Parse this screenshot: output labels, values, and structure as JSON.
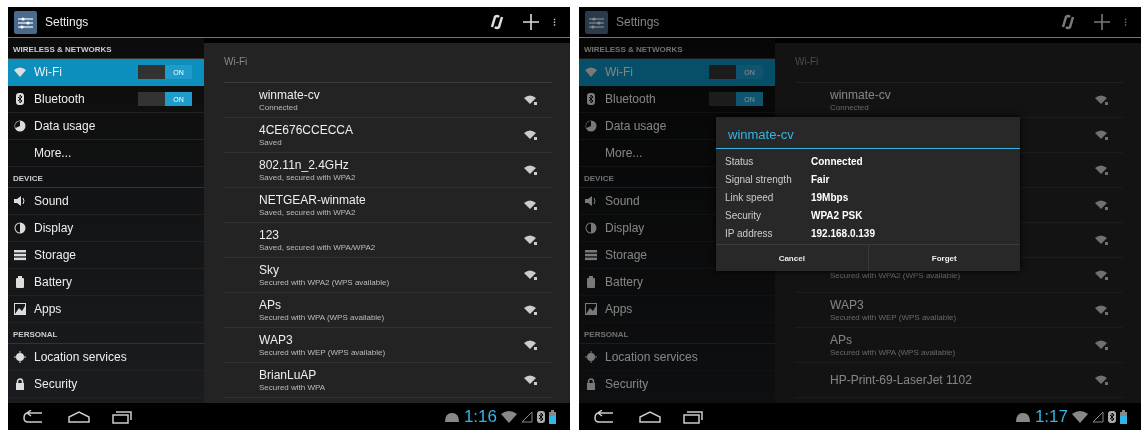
{
  "screens": [
    {
      "dimmed": false,
      "action_bar": {
        "title": "Settings"
      },
      "sidebar": [
        {
          "heading": "WIRELESS & NETWORKS",
          "items": [
            {
              "kind": "wifi",
              "label": "Wi-Fi",
              "selected": true,
              "switch": {
                "label": "ON",
                "on": true
              }
            },
            {
              "kind": "bluetooth",
              "label": "Bluetooth",
              "selected": false,
              "switch": {
                "label": "ON",
                "on": true
              }
            },
            {
              "kind": "data",
              "label": "Data usage",
              "selected": false
            },
            {
              "kind": "none",
              "label": "More...",
              "selected": false
            }
          ]
        },
        {
          "heading": "DEVICE",
          "items": [
            {
              "kind": "sound",
              "label": "Sound",
              "selected": false
            },
            {
              "kind": "display",
              "label": "Display",
              "selected": false
            },
            {
              "kind": "storage",
              "label": "Storage",
              "selected": false
            },
            {
              "kind": "battery",
              "label": "Battery",
              "selected": false
            },
            {
              "kind": "apps",
              "label": "Apps",
              "selected": false
            }
          ]
        },
        {
          "heading": "PERSONAL",
          "items": [
            {
              "kind": "location",
              "label": "Location services",
              "selected": false
            },
            {
              "kind": "lock",
              "label": "Security",
              "selected": false
            }
          ]
        }
      ],
      "panel": {
        "title": "Wi-Fi",
        "networks": [
          {
            "kind": "network",
            "ssid": "winmate-cv",
            "status": "Connected"
          },
          {
            "kind": "network",
            "ssid": "4CE676CCECCA",
            "status": "Saved"
          },
          {
            "kind": "network",
            "ssid": "802.11n_2.4GHz",
            "status": "Saved, secured with WPA2"
          },
          {
            "kind": "network",
            "ssid": "NETGEAR-winmate",
            "status": "Saved, secured with WPA2"
          },
          {
            "kind": "network",
            "ssid": "123",
            "status": "Saved, secured with WPA/WPA2"
          },
          {
            "kind": "network",
            "ssid": "Sky",
            "status": "Secured with WPA2 (WPS available)"
          },
          {
            "kind": "network",
            "ssid": "APs",
            "status": "Secured with WPA (WPS available)"
          },
          {
            "kind": "network",
            "ssid": "WAP3",
            "status": "Secured with WEP (WPS available)"
          },
          {
            "kind": "network",
            "ssid": "BrianLuAP",
            "status": "Secured with WPA"
          }
        ]
      },
      "status_bar": {
        "time": "1:16"
      }
    },
    {
      "dimmed": true,
      "action_bar": {
        "title": "Settings"
      },
      "sidebar": [
        {
          "heading": "WIRELESS & NETWORKS",
          "items": [
            {
              "kind": "wifi",
              "label": "Wi-Fi",
              "selected": true,
              "switch": {
                "label": "ON",
                "on": true
              }
            },
            {
              "kind": "bluetooth",
              "label": "Bluetooth",
              "selected": false,
              "switch": {
                "label": "ON",
                "on": true
              }
            },
            {
              "kind": "data",
              "label": "Data usage",
              "selected": false
            },
            {
              "kind": "none",
              "label": "More...",
              "selected": false
            }
          ]
        },
        {
          "heading": "DEVICE",
          "items": [
            {
              "kind": "sound",
              "label": "Sound",
              "selected": false
            },
            {
              "kind": "display",
              "label": "Display",
              "selected": false
            },
            {
              "kind": "storage",
              "label": "Storage",
              "selected": false
            },
            {
              "kind": "battery",
              "label": "Battery",
              "selected": false
            },
            {
              "kind": "apps",
              "label": "Apps",
              "selected": false
            }
          ]
        },
        {
          "heading": "PERSONAL",
          "items": [
            {
              "kind": "location",
              "label": "Location services",
              "selected": false
            },
            {
              "kind": "lock",
              "label": "Security",
              "selected": false
            }
          ]
        }
      ],
      "panel": {
        "title": "Wi-Fi",
        "networks": [
          {
            "kind": "network",
            "ssid": "winmate-cv",
            "status": "Connected"
          },
          {
            "kind": "covered"
          },
          {
            "kind": "covered"
          },
          {
            "kind": "covered"
          },
          {
            "kind": "covered"
          },
          {
            "kind": "network",
            "status": "Secured with WPA2 (WPS available)"
          },
          {
            "kind": "network",
            "ssid": "WAP3",
            "status": "Secured with WEP (WPS available)"
          },
          {
            "kind": "network",
            "ssid": "APs",
            "status": "Secured with WPA (WPS available)"
          },
          {
            "kind": "network",
            "ssid": "HP-Print-69-LaserJet 1102"
          }
        ]
      },
      "dialog": {
        "title": "winmate-cv",
        "fields": [
          {
            "label": "Status",
            "value": "Connected"
          },
          {
            "label": "Signal strength",
            "value": "Fair"
          },
          {
            "label": "Link speed",
            "value": "19Mbps"
          },
          {
            "label": "Security",
            "value": "WPA2 PSK"
          },
          {
            "label": "IP address",
            "value": "192.168.0.139"
          }
        ],
        "buttons": [
          "Cancel",
          "Forget"
        ]
      },
      "status_bar": {
        "time": "1:17"
      }
    }
  ]
}
